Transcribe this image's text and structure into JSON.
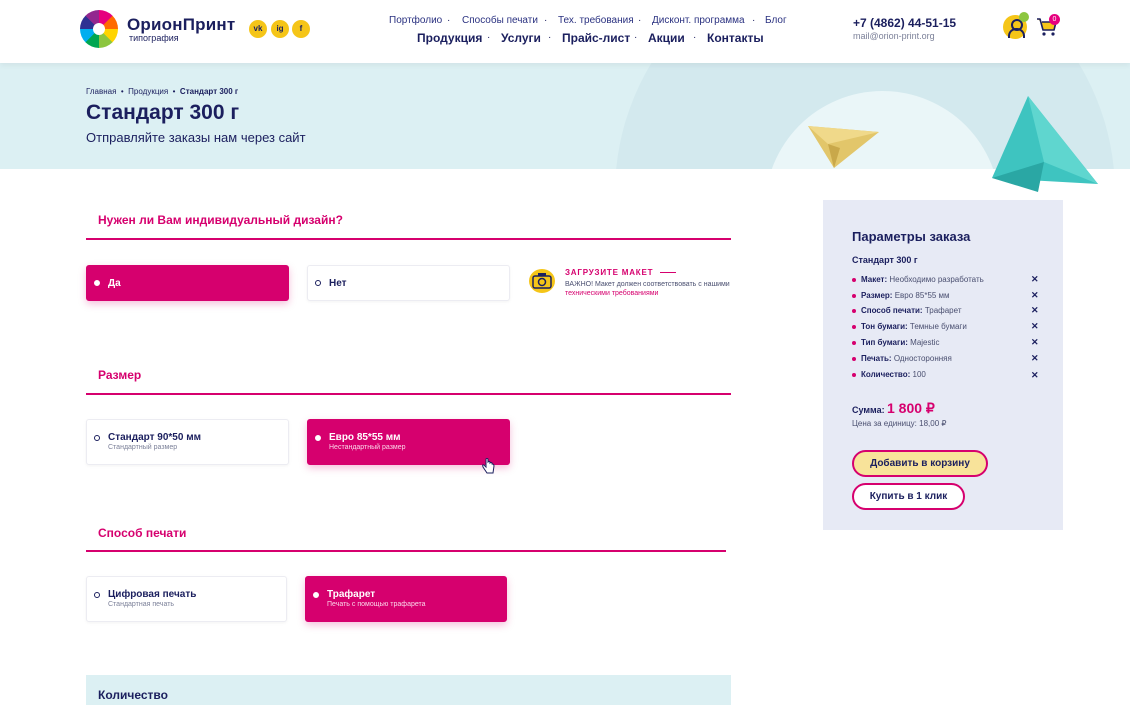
{
  "header": {
    "brand": "ОрионПринт",
    "brand_sub": "типография",
    "social": [
      "vk-icon",
      "instagram-icon",
      "facebook-icon"
    ],
    "social_labels": [
      "vk",
      "ig",
      "f"
    ],
    "nav_top": [
      "Портфолио",
      "Способы печати",
      "Тех. требования",
      "Дисконт. программа",
      "Блог"
    ],
    "nav_main": [
      "Продукция",
      "Услуги",
      "Прайс-лист",
      "Акции",
      "Контакты"
    ],
    "phone": "+7 (4862) 44-51-15",
    "email": "mail@orion-print.org",
    "cart_count": "0"
  },
  "hero": {
    "breadcrumb": [
      "Главная",
      "Продукция",
      "Стандарт 300 г"
    ],
    "title": "Стандарт 300 г",
    "subtitle": "Отправляйте заказы нам через сайт"
  },
  "design": {
    "title": "Нужен ли Вам индивидуальный дизайн?",
    "options": [
      {
        "label": "Да",
        "active": true
      },
      {
        "label": "Нет",
        "active": false
      }
    ],
    "upload_title": "ЗАГРУЗИТЕ МАКЕТ",
    "upload_note_prefix": "ВАЖНО! Макет должен соответствовать с нашими",
    "upload_note_link": "техническими требованиями"
  },
  "size": {
    "title": "Размер",
    "options": [
      {
        "label": "Стандарт 90*50 мм",
        "sub": "Стандартный размер",
        "active": false
      },
      {
        "label": "Евро 85*55 мм",
        "sub": "Нестандартный размер",
        "active": true
      }
    ]
  },
  "print": {
    "title": "Способ печати",
    "options": [
      {
        "label": "Цифровая печать",
        "sub": "Стандартная печать",
        "active": false
      },
      {
        "label": "Трафарет",
        "sub": "Печать с помощью трафарета",
        "active": true
      }
    ]
  },
  "quantity": {
    "title": "Количество"
  },
  "summary": {
    "title": "Параметры заказа",
    "product": "Стандарт 300 г",
    "params": [
      {
        "key": "Макет:",
        "value": "Необходимо разработать"
      },
      {
        "key": "Размер:",
        "value": "Евро 85*55 мм"
      },
      {
        "key": "Способ печати:",
        "value": "Трафарет"
      },
      {
        "key": "Тон бумаги:",
        "value": "Темные бумаги"
      },
      {
        "key": "Тип бумаги:",
        "value": "Majestic"
      },
      {
        "key": "Печать:",
        "value": "Односторонняя"
      },
      {
        "key": "Количество:",
        "value": "100"
      }
    ],
    "remove_symbol": "✕",
    "sum_label": "Сумма:",
    "sum_value": "1 800 ₽",
    "unit_price": "Цена за единицу: 18,00 ₽",
    "btn_cart": "Добавить в корзину",
    "btn_oneclick": "Купить в 1 клик"
  },
  "colors": {
    "accent": "#d6006e",
    "brand_dark": "#1b1f5e",
    "yellow": "#f5c518",
    "hero_bg": "#dcf0f3",
    "panel_bg": "#e7eaf5"
  }
}
